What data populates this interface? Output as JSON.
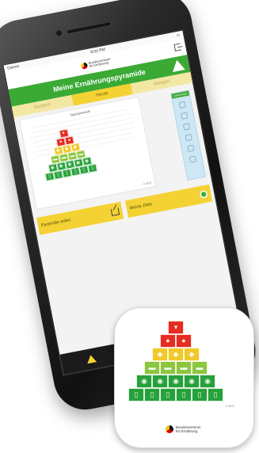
{
  "status_bar": {
    "carrier": "Carrier",
    "time": "8:02 PM",
    "battery": ""
  },
  "app_logo": {
    "line1": "Bundeszentrum",
    "line2": "für Ernährung"
  },
  "title": "Meine Ernährungspyramide",
  "tabs": [
    {
      "label": "Gestern",
      "active": false
    },
    {
      "label": "Heute",
      "active": true
    },
    {
      "label": "Morgen",
      "active": false
    }
  ],
  "pyramid_card": {
    "title": "Tagesprotokoll",
    "note": "© BLE"
  },
  "side_column": {
    "header": "Lebensmittel"
  },
  "actions": {
    "left_label": "Pyramide teilen",
    "right_label": "Meine Ziele"
  },
  "bottom_tabs": [
    {
      "icon": "pyramid-icon"
    },
    {
      "icon": "star-icon"
    },
    {
      "icon": "home-icon"
    }
  ],
  "app_icon_caption": "© BLE",
  "colors": {
    "green": "#3aaa35",
    "yellow": "#f5d233",
    "red": "#e42d20",
    "light_green": "#8cc63f"
  }
}
